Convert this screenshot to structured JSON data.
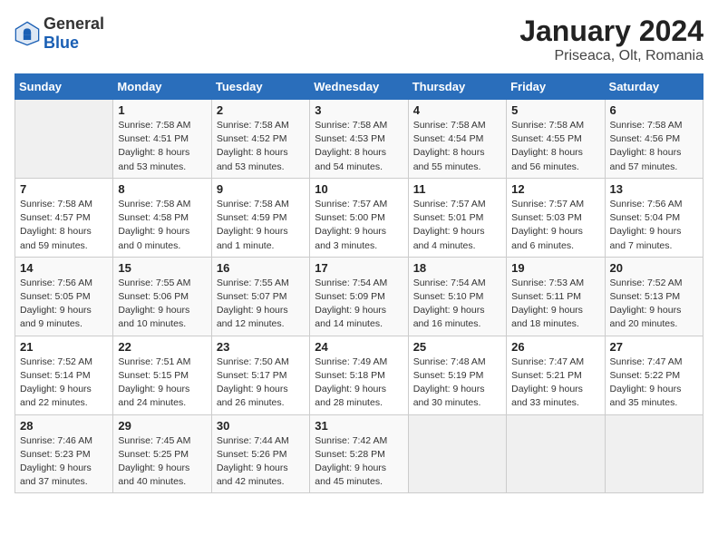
{
  "header": {
    "logo_general": "General",
    "logo_blue": "Blue",
    "title": "January 2024",
    "subtitle": "Priseaca, Olt, Romania"
  },
  "calendar": {
    "days_of_week": [
      "Sunday",
      "Monday",
      "Tuesday",
      "Wednesday",
      "Thursday",
      "Friday",
      "Saturday"
    ],
    "weeks": [
      [
        {
          "day": "",
          "info": ""
        },
        {
          "day": "1",
          "info": "Sunrise: 7:58 AM\nSunset: 4:51 PM\nDaylight: 8 hours\nand 53 minutes."
        },
        {
          "day": "2",
          "info": "Sunrise: 7:58 AM\nSunset: 4:52 PM\nDaylight: 8 hours\nand 53 minutes."
        },
        {
          "day": "3",
          "info": "Sunrise: 7:58 AM\nSunset: 4:53 PM\nDaylight: 8 hours\nand 54 minutes."
        },
        {
          "day": "4",
          "info": "Sunrise: 7:58 AM\nSunset: 4:54 PM\nDaylight: 8 hours\nand 55 minutes."
        },
        {
          "day": "5",
          "info": "Sunrise: 7:58 AM\nSunset: 4:55 PM\nDaylight: 8 hours\nand 56 minutes."
        },
        {
          "day": "6",
          "info": "Sunrise: 7:58 AM\nSunset: 4:56 PM\nDaylight: 8 hours\nand 57 minutes."
        }
      ],
      [
        {
          "day": "7",
          "info": "Sunrise: 7:58 AM\nSunset: 4:57 PM\nDaylight: 8 hours\nand 59 minutes."
        },
        {
          "day": "8",
          "info": "Sunrise: 7:58 AM\nSunset: 4:58 PM\nDaylight: 9 hours\nand 0 minutes."
        },
        {
          "day": "9",
          "info": "Sunrise: 7:58 AM\nSunset: 4:59 PM\nDaylight: 9 hours\nand 1 minute."
        },
        {
          "day": "10",
          "info": "Sunrise: 7:57 AM\nSunset: 5:00 PM\nDaylight: 9 hours\nand 3 minutes."
        },
        {
          "day": "11",
          "info": "Sunrise: 7:57 AM\nSunset: 5:01 PM\nDaylight: 9 hours\nand 4 minutes."
        },
        {
          "day": "12",
          "info": "Sunrise: 7:57 AM\nSunset: 5:03 PM\nDaylight: 9 hours\nand 6 minutes."
        },
        {
          "day": "13",
          "info": "Sunrise: 7:56 AM\nSunset: 5:04 PM\nDaylight: 9 hours\nand 7 minutes."
        }
      ],
      [
        {
          "day": "14",
          "info": "Sunrise: 7:56 AM\nSunset: 5:05 PM\nDaylight: 9 hours\nand 9 minutes."
        },
        {
          "day": "15",
          "info": "Sunrise: 7:55 AM\nSunset: 5:06 PM\nDaylight: 9 hours\nand 10 minutes."
        },
        {
          "day": "16",
          "info": "Sunrise: 7:55 AM\nSunset: 5:07 PM\nDaylight: 9 hours\nand 12 minutes."
        },
        {
          "day": "17",
          "info": "Sunrise: 7:54 AM\nSunset: 5:09 PM\nDaylight: 9 hours\nand 14 minutes."
        },
        {
          "day": "18",
          "info": "Sunrise: 7:54 AM\nSunset: 5:10 PM\nDaylight: 9 hours\nand 16 minutes."
        },
        {
          "day": "19",
          "info": "Sunrise: 7:53 AM\nSunset: 5:11 PM\nDaylight: 9 hours\nand 18 minutes."
        },
        {
          "day": "20",
          "info": "Sunrise: 7:52 AM\nSunset: 5:13 PM\nDaylight: 9 hours\nand 20 minutes."
        }
      ],
      [
        {
          "day": "21",
          "info": "Sunrise: 7:52 AM\nSunset: 5:14 PM\nDaylight: 9 hours\nand 22 minutes."
        },
        {
          "day": "22",
          "info": "Sunrise: 7:51 AM\nSunset: 5:15 PM\nDaylight: 9 hours\nand 24 minutes."
        },
        {
          "day": "23",
          "info": "Sunrise: 7:50 AM\nSunset: 5:17 PM\nDaylight: 9 hours\nand 26 minutes."
        },
        {
          "day": "24",
          "info": "Sunrise: 7:49 AM\nSunset: 5:18 PM\nDaylight: 9 hours\nand 28 minutes."
        },
        {
          "day": "25",
          "info": "Sunrise: 7:48 AM\nSunset: 5:19 PM\nDaylight: 9 hours\nand 30 minutes."
        },
        {
          "day": "26",
          "info": "Sunrise: 7:47 AM\nSunset: 5:21 PM\nDaylight: 9 hours\nand 33 minutes."
        },
        {
          "day": "27",
          "info": "Sunrise: 7:47 AM\nSunset: 5:22 PM\nDaylight: 9 hours\nand 35 minutes."
        }
      ],
      [
        {
          "day": "28",
          "info": "Sunrise: 7:46 AM\nSunset: 5:23 PM\nDaylight: 9 hours\nand 37 minutes."
        },
        {
          "day": "29",
          "info": "Sunrise: 7:45 AM\nSunset: 5:25 PM\nDaylight: 9 hours\nand 40 minutes."
        },
        {
          "day": "30",
          "info": "Sunrise: 7:44 AM\nSunset: 5:26 PM\nDaylight: 9 hours\nand 42 minutes."
        },
        {
          "day": "31",
          "info": "Sunrise: 7:42 AM\nSunset: 5:28 PM\nDaylight: 9 hours\nand 45 minutes."
        },
        {
          "day": "",
          "info": ""
        },
        {
          "day": "",
          "info": ""
        },
        {
          "day": "",
          "info": ""
        }
      ]
    ]
  }
}
